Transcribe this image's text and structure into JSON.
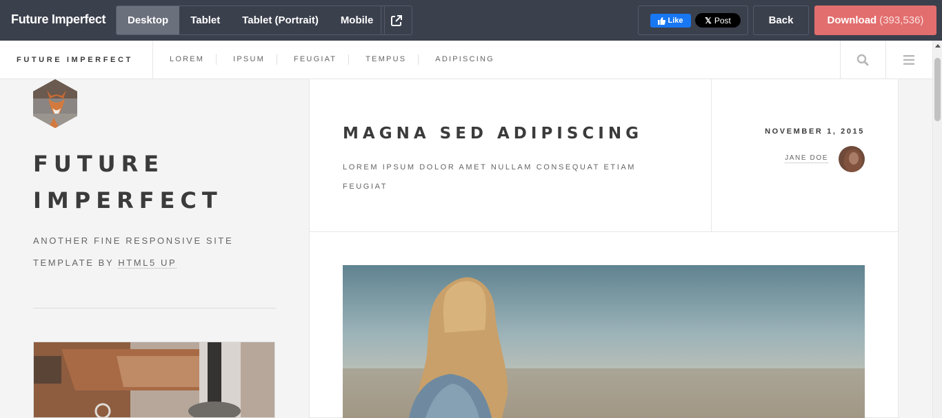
{
  "preview_bar": {
    "brand": "Future Imperfect",
    "devices": [
      "Desktop",
      "Tablet",
      "Tablet (Portrait)",
      "Mobile"
    ],
    "active_device": "Desktop",
    "fb_like": "Like",
    "x_post": "Post",
    "back": "Back",
    "download": "Download",
    "download_count": "(393,536)",
    "colors": {
      "bar": "#3b404d",
      "download": "#e36e6e",
      "fb": "#1877f2"
    }
  },
  "site": {
    "logo": "FUTURE IMPERFECT",
    "nav": [
      "LOREM",
      "IPSUM",
      "FEUGIAT",
      "TEMPUS",
      "ADIPISCING"
    ],
    "icons": [
      "search-icon",
      "menu-icon"
    ]
  },
  "intro": {
    "title_line1": "FUTURE",
    "title_line2": "IMPERFECT",
    "subtitle": "ANOTHER FINE RESPONSIVE SITE TEMPLATE BY",
    "subtitle_link": "HTML5 UP"
  },
  "post": {
    "title": "MAGNA SED ADIPISCING",
    "subtitle": "LOREM IPSUM DOLOR AMET NULLAM CONSEQUAT ETIAM FEUGIAT",
    "date": "NOVEMBER 1, 2015",
    "author": "JANE DOE"
  }
}
